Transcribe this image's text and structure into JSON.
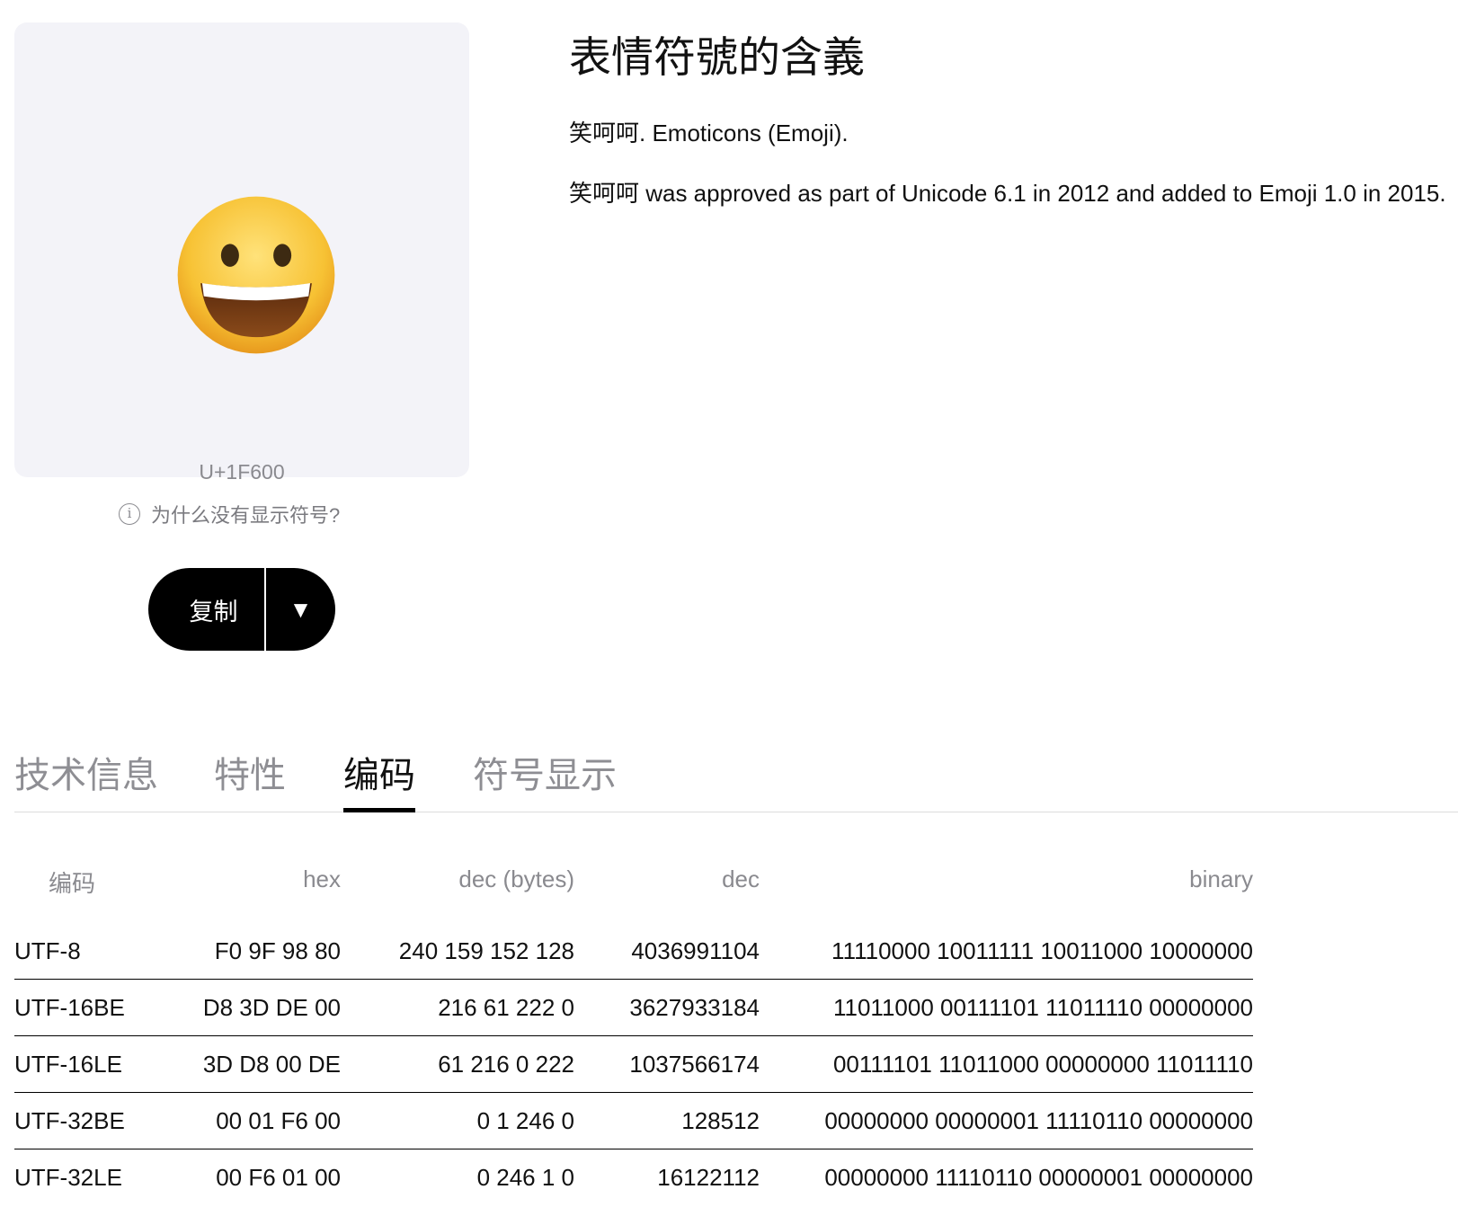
{
  "preview": {
    "codepoint": "U+1F600",
    "help_text": "为什么没有显示符号?",
    "copy_label": "复制",
    "dropdown_glyph": "▼",
    "emoji_icon": "grinning-face"
  },
  "meaning": {
    "title": "表情符號的含義",
    "description": "笑呵呵. Emoticons (Emoji).",
    "history": "笑呵呵 was approved as part of Unicode 6.1 in 2012 and added to Emoji 1.0 in 2015."
  },
  "tabs": [
    {
      "label": "技术信息",
      "active": false
    },
    {
      "label": "特性",
      "active": false
    },
    {
      "label": "编码",
      "active": true
    },
    {
      "label": "符号显示",
      "active": false
    }
  ],
  "encoding_table": {
    "headers": [
      "编码",
      "hex",
      "dec (bytes)",
      "dec",
      "binary"
    ],
    "rows": [
      [
        "UTF-8",
        "F0 9F 98 80",
        "240 159 152 128",
        "4036991104",
        "11110000 10011111 10011000 10000000"
      ],
      [
        "UTF-16BE",
        "D8 3D DE 00",
        "216 61 222 0",
        "3627933184",
        "11011000 00111101 11011110 00000000"
      ],
      [
        "UTF-16LE",
        "3D D8 00 DE",
        "61 216 0 222",
        "1037566174",
        "00111101 11011000 00000000 11011110"
      ],
      [
        "UTF-32BE",
        "00 01 F6 00",
        "0 1 246 0",
        "128512",
        "00000000 00000001 11110110 00000000"
      ],
      [
        "UTF-32LE",
        "00 F6 01 00",
        "0 246 1 0",
        "16122112",
        "00000000 11110110 00000001 00000000"
      ]
    ]
  },
  "colors": {
    "card_bg": "#f3f3f8",
    "button_bg": "#000000",
    "muted_text": "#8a8a8f",
    "emoji_yellow": "#f7c234"
  }
}
